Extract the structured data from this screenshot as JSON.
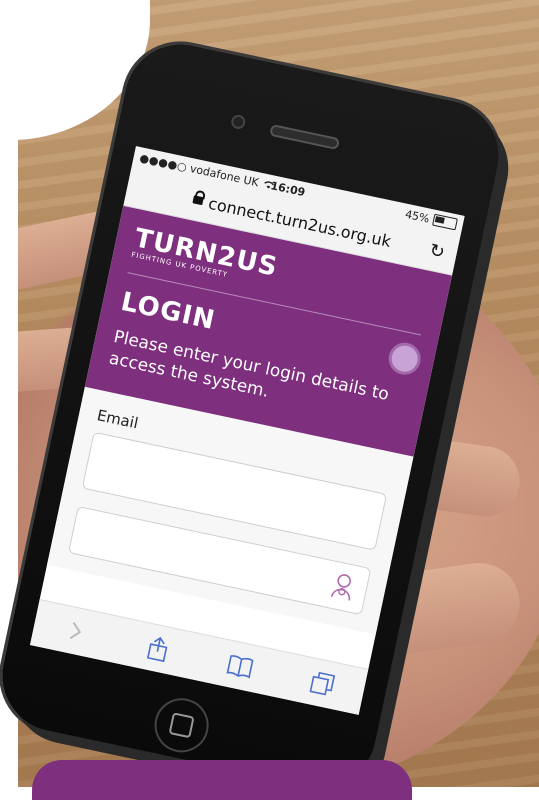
{
  "status_bar": {
    "carrier": "●●●●○ vodafone UK",
    "time": "16:09",
    "battery": "45%"
  },
  "address_bar": {
    "url": "connect.turn2us.org.uk"
  },
  "brand": {
    "name": "TURN2US",
    "tagline": "FIGHTING UK POVERTY"
  },
  "login": {
    "title": "LOGIN",
    "description": "Please enter your login details to access the system."
  },
  "form": {
    "email_label": "Email",
    "email_value": ""
  },
  "colors": {
    "brand_purple": "#7e2f7e",
    "accent_lilac": "#c8a3d6"
  },
  "icons": {
    "lock": "lock-icon",
    "reload": "reload-icon",
    "wifi": "wifi-icon",
    "battery": "battery-icon",
    "profile": "profile-icon",
    "share": "share-icon",
    "bookmarks": "bookmarks-icon",
    "tabs": "tabs-icon",
    "forward": "forward-icon"
  }
}
